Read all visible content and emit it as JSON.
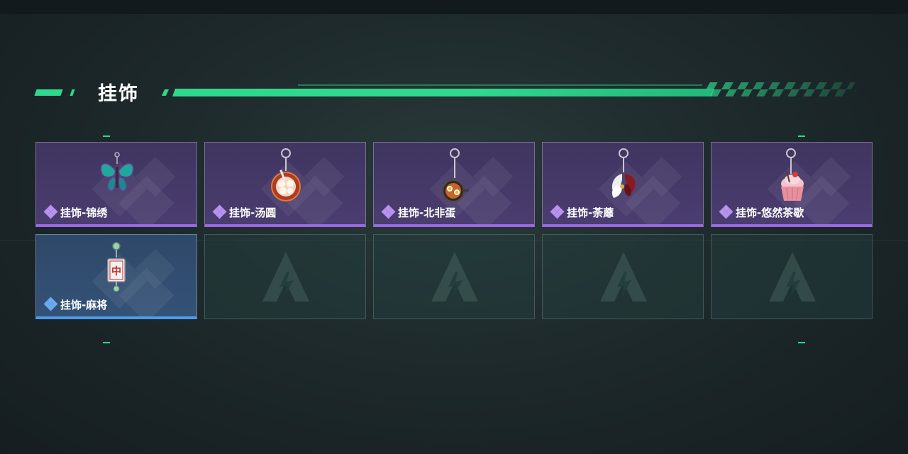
{
  "header": {
    "title": "挂饰"
  },
  "theme": {
    "accent": "#2ed98e",
    "rare_purple": "#9a68e0",
    "rare_blue": "#4f9ae8"
  },
  "items": [
    {
      "label": "挂饰-锦绣",
      "rarity": "purple",
      "icon": "butterfly-charm-icon"
    },
    {
      "label": "挂饰-汤圆",
      "rarity": "purple",
      "icon": "tangyuan-bowl-charm-icon"
    },
    {
      "label": "挂饰-北非蛋",
      "rarity": "purple",
      "icon": "shakshuka-pan-charm-icon"
    },
    {
      "label": "挂饰-荼蘼",
      "rarity": "purple",
      "icon": "flower-charm-icon"
    },
    {
      "label": "挂饰-悠然茶歇",
      "rarity": "purple",
      "icon": "cupcake-charm-icon"
    },
    {
      "label": "挂饰-麻将",
      "rarity": "blue",
      "icon": "mahjong-tile-charm-icon"
    }
  ],
  "empty_slots": 4,
  "empty_slot_icon": "game-logo-icon"
}
